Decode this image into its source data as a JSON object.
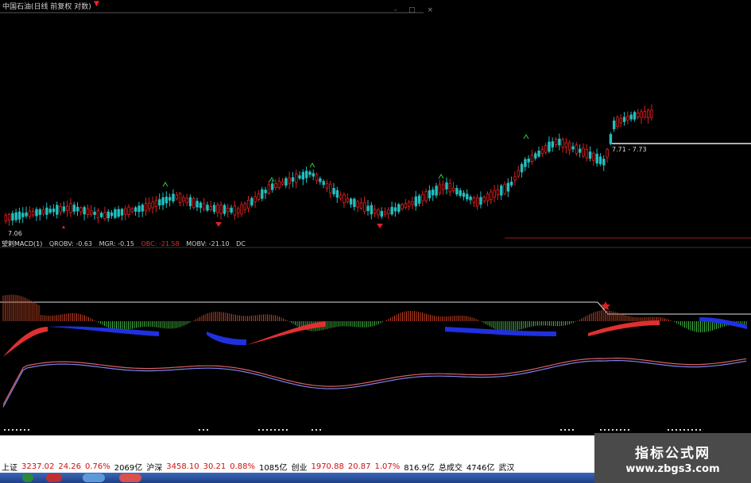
{
  "window": {
    "title": "中国石油(日线 前复权 对数)",
    "title_arrow": "▼",
    "buttons": "- □ ×"
  },
  "price_panel": {
    "low_label": "7.06",
    "range_label": "7.71 - 7.73",
    "up_color": "#e02020",
    "down_color": "#20c0c0"
  },
  "indicator_bar": {
    "name": "望剌MACD(1)",
    "qrobv": "QROBV: -0.63",
    "mgr": "MGR: -0.15",
    "obc": "OBC: -21.58",
    "mobv": "MOBV: -21.10",
    "dc": "DC"
  },
  "status_bar": {
    "sh_label": "上证",
    "sh_index": "3237.02",
    "sh_change": "24.26",
    "sh_pct": "0.76%",
    "sh_vol": "2069亿",
    "hs_label": "沪深",
    "hs_index": "3458.10",
    "hs_change": "30.21",
    "hs_pct": "0.88%",
    "hs_vol": "1085亿",
    "cy_label": "创业",
    "cy_index": "1970.88",
    "cy_change": "20.87",
    "cy_pct": "1.07%",
    "cy_vol": "816.9亿",
    "total_label": "总成交",
    "total_vol": "4746亿",
    "extra": "武汉"
  },
  "brand": {
    "title": "指标公式网",
    "url": "www.zbgs3.com"
  }
}
